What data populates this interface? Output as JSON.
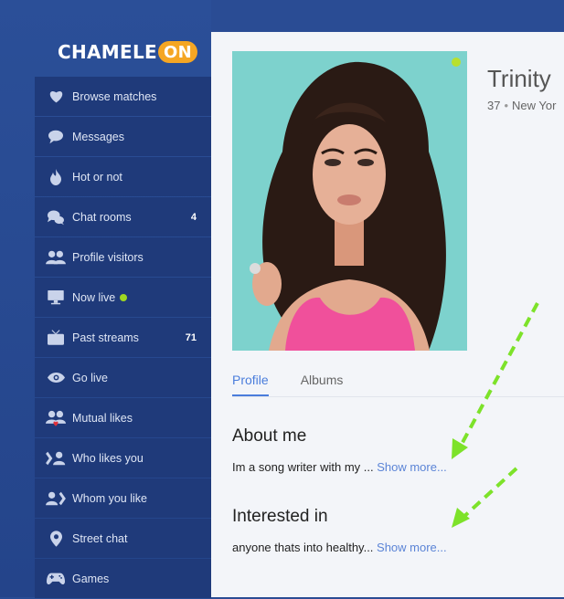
{
  "logo": {
    "text": "CHAMELE",
    "badge": "ON"
  },
  "nav": [
    {
      "label": "Browse matches",
      "icon": "heart-icon"
    },
    {
      "label": "Messages",
      "icon": "chat-bubble-icon"
    },
    {
      "label": "Hot or not",
      "icon": "flame-icon"
    },
    {
      "label": "Chat rooms",
      "icon": "chat-rooms-icon",
      "count": "4"
    },
    {
      "label": "Profile visitors",
      "icon": "visitors-icon"
    },
    {
      "label": "Now live",
      "icon": "monitor-icon",
      "live": true
    },
    {
      "label": "Past streams",
      "icon": "tv-icon",
      "count": "71"
    },
    {
      "label": "Go live",
      "icon": "eye-icon"
    },
    {
      "label": "Mutual likes",
      "icon": "mutual-likes-icon"
    },
    {
      "label": "Who likes you",
      "icon": "who-likes-you-icon"
    },
    {
      "label": "Whom you like",
      "icon": "whom-you-like-icon"
    },
    {
      "label": "Street chat",
      "icon": "map-pin-icon"
    },
    {
      "label": "Games",
      "icon": "gamepad-icon"
    }
  ],
  "profile": {
    "name": "Trinity",
    "age": "37",
    "location": "New Yor",
    "online": true
  },
  "tabs": [
    {
      "label": "Profile"
    },
    {
      "label": "Albums"
    }
  ],
  "about": {
    "title": "About me",
    "text": "Im a song writer with my ... ",
    "more": "Show more..."
  },
  "interested": {
    "title": "Interested in",
    "text": "anyone thats into healthy... ",
    "more": "Show more..."
  },
  "colors": {
    "sidebar": "#2b4f98",
    "nav_item": "#1f3a7a",
    "accent": "#4a7ddc",
    "logo_badge": "#f5a623",
    "online": "#b8e02e",
    "annotation_arrow": "#7de22a"
  }
}
